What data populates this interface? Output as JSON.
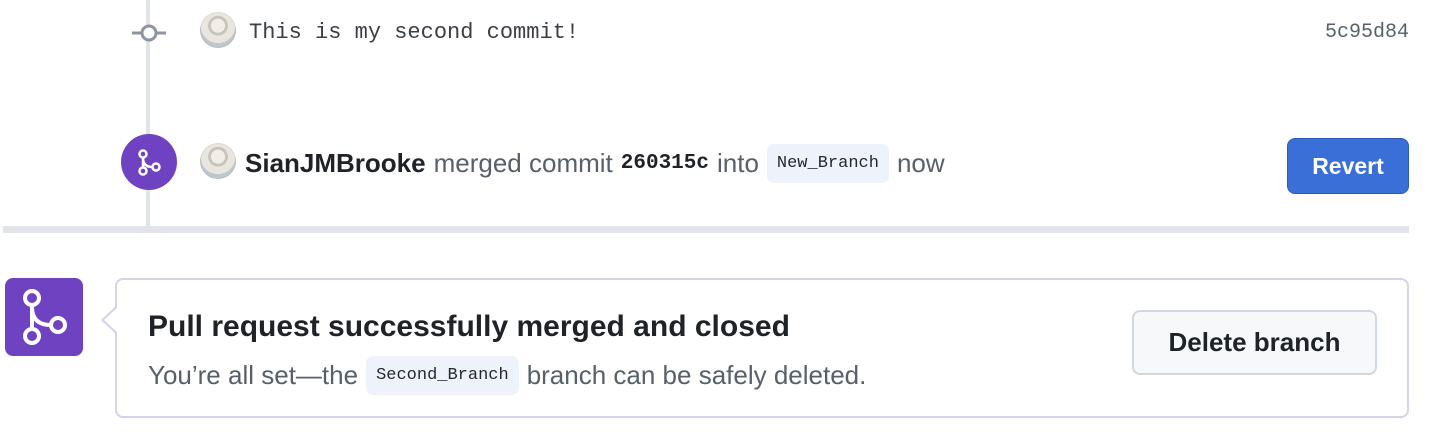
{
  "commit": {
    "message": "This is my second commit!",
    "sha": "5c95d84"
  },
  "merge_event": {
    "user": "SianJMBrooke",
    "action": "merged commit",
    "commit_sha": "260315c",
    "into": "into",
    "branch": "New_Branch",
    "time": "now",
    "revert_label": "Revert"
  },
  "merged_card": {
    "title": "Pull request successfully merged and closed",
    "sub_prefix": "You’re all set—the",
    "branch": "Second_Branch",
    "sub_suffix": "branch can be safely deleted.",
    "delete_label": "Delete branch"
  },
  "colors": {
    "merged_purple": "#6f42c1",
    "revert_blue": "#3a6fd8"
  },
  "icons": {
    "commit": "git-commit-icon",
    "merge": "git-merge-icon"
  }
}
